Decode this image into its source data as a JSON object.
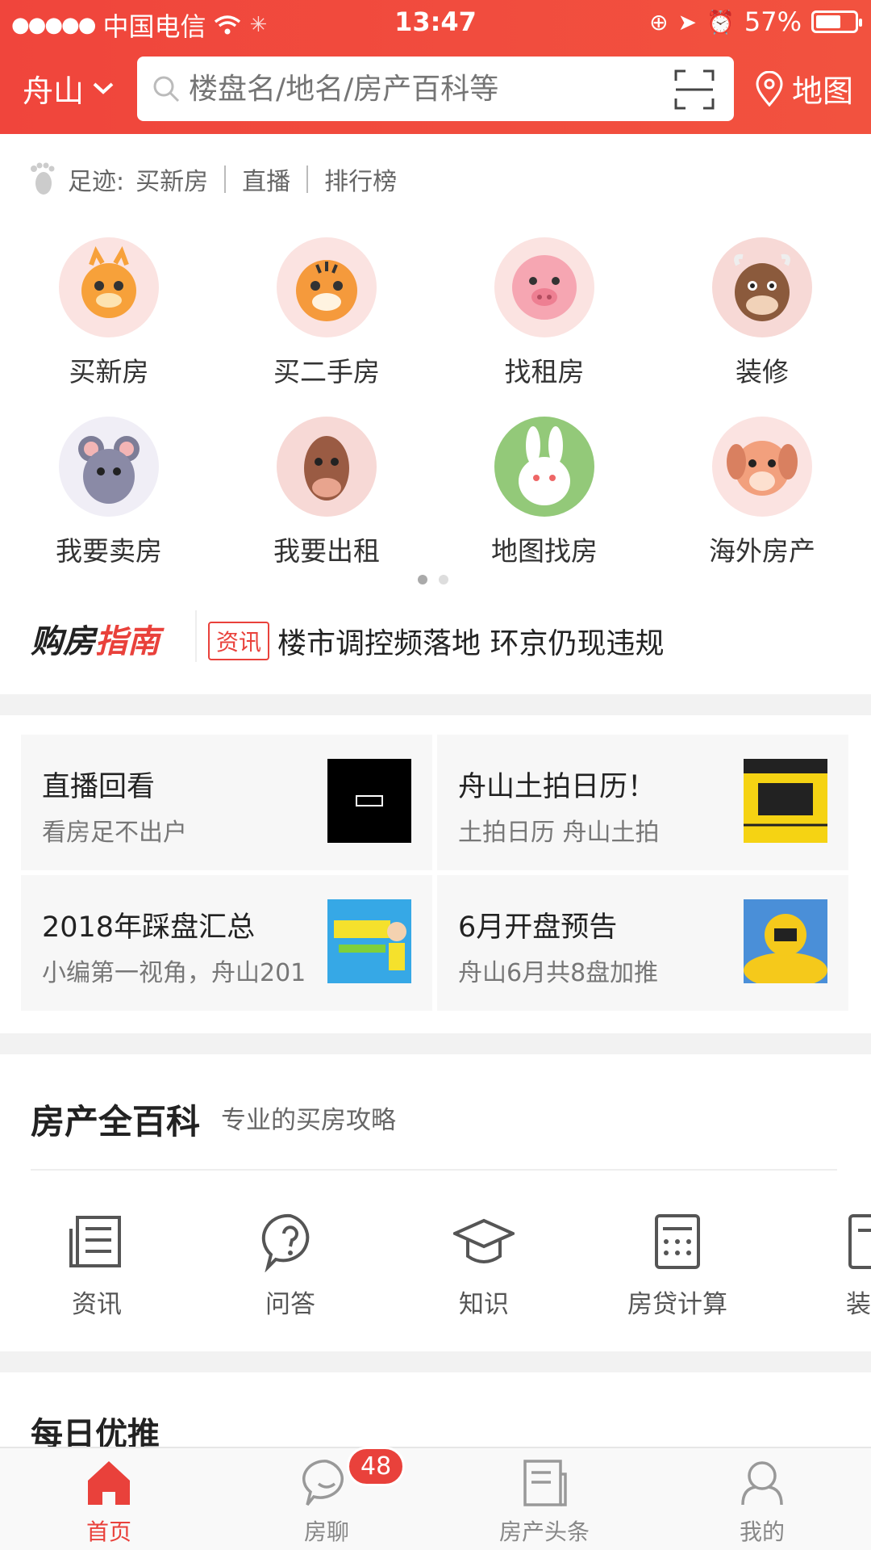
{
  "statusbar": {
    "carrier": "中国电信",
    "time": "13:47",
    "battery": "57%",
    "battery_level": 0.57
  },
  "header": {
    "city": "舟山",
    "search_placeholder": "楼盘名/地名/房产百科等",
    "map_label": "地图"
  },
  "footprint": {
    "label": "足迹:",
    "items": [
      "买新房",
      "直播",
      "排行榜"
    ]
  },
  "grid": {
    "items": [
      {
        "label": "买新房",
        "icon": "dragon-icon"
      },
      {
        "label": "买二手房",
        "icon": "tiger-icon"
      },
      {
        "label": "找租房",
        "icon": "pig-icon"
      },
      {
        "label": "装修",
        "icon": "ox-icon"
      },
      {
        "label": "我要卖房",
        "icon": "mouse-icon"
      },
      {
        "label": "我要出租",
        "icon": "horse-icon"
      },
      {
        "label": "地图找房",
        "icon": "rabbit-icon"
      },
      {
        "label": "海外房产",
        "icon": "dog-icon"
      }
    ],
    "page": 1,
    "pages": 2
  },
  "guide": {
    "logo_a": "购房",
    "logo_b": "指南",
    "badge": "资讯",
    "headline": "楼市调控频落地 环京仍现违规"
  },
  "cards": [
    {
      "title": "直播回看",
      "sub": "看房足不出户"
    },
    {
      "title": "舟山土拍日历！",
      "sub": "土拍日历 舟山土拍"
    },
    {
      "title": "2018年踩盘汇总",
      "sub": "小编第一视角，舟山201"
    },
    {
      "title": "6月开盘预告",
      "sub": "舟山6月共8盘加推"
    }
  ],
  "wiki": {
    "title": "房产全百科",
    "subtitle": "专业的买房攻略",
    "items": [
      {
        "label": "资讯",
        "icon": "news-icon"
      },
      {
        "label": "问答",
        "icon": "question-icon"
      },
      {
        "label": "知识",
        "icon": "graduation-cap-icon"
      },
      {
        "label": "房贷计算",
        "icon": "calculator-icon"
      },
      {
        "label": "装修",
        "icon": "decor-icon"
      }
    ]
  },
  "daily": {
    "title": "每日优推"
  },
  "tabbar": {
    "tabs": [
      {
        "label": "首页",
        "icon": "home-icon"
      },
      {
        "label": "房聊",
        "icon": "chat-icon"
      },
      {
        "label": "房产头条",
        "icon": "headlines-icon"
      },
      {
        "label": "我的",
        "icon": "profile-icon"
      }
    ],
    "chat_badge": "48"
  },
  "colors": {
    "brand": "#f0453c",
    "accent_red": "#e9413b"
  }
}
